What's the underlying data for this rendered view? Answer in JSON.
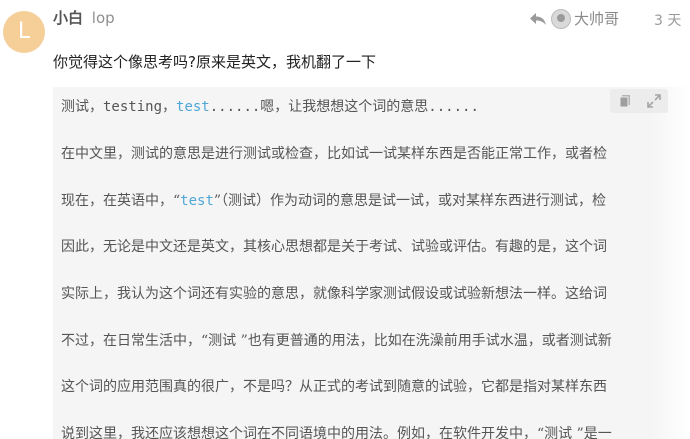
{
  "post": {
    "avatar_letter": "L",
    "avatar_color": "#f6cf98",
    "display_name": "小白",
    "username": "lop",
    "reply_to": {
      "icon": "reply-arrow-icon",
      "name": "大帅哥"
    },
    "date": "3 天",
    "text": "你觉得这个像思考吗?原来是英文，我机翻了一下"
  },
  "codeblock": {
    "toolbar": {
      "copy_icon": "copy-icon",
      "expand_icon": "expand-icon"
    },
    "lines": [
      {
        "pre": "测试，testing，",
        "kw": "test",
        "post": "......嗯，让我想想这个词的意思......"
      },
      {
        "pre": "在中文里，测试的意思是进行测试或检查，比如试一试某样东西是否能正常工作，或者检",
        "kw": "",
        "post": ""
      },
      {
        "pre": "现在，在英语中，“",
        "kw": "test",
        "post": "”（测试）作为动词的意思是试一试，或对某样东西进行测试，检"
      },
      {
        "pre": "因此，无论是中文还是英文，其核心思想都是关于考试、试验或评估。有趣的是，这个词",
        "kw": "",
        "post": ""
      },
      {
        "pre": "实际上，我认为这个词还有实验的意思，就像科学家测试假设或试验新想法一样。这给词",
        "kw": "",
        "post": ""
      },
      {
        "pre": "不过，在日常生活中，“测试 ”也有更普通的用法，比如在洗澡前用手试水温，或者测试新",
        "kw": "",
        "post": ""
      },
      {
        "pre": "这个词的应用范围真的很广，不是吗？从正式的考试到随意的试验，它都是指对某样东西",
        "kw": "",
        "post": ""
      },
      {
        "pre": "说到这里，我还应该想想这个词在不同语境中的用法。例如，在软件开发中，“测试 ”是一",
        "kw": "",
        "post": ""
      }
    ]
  }
}
